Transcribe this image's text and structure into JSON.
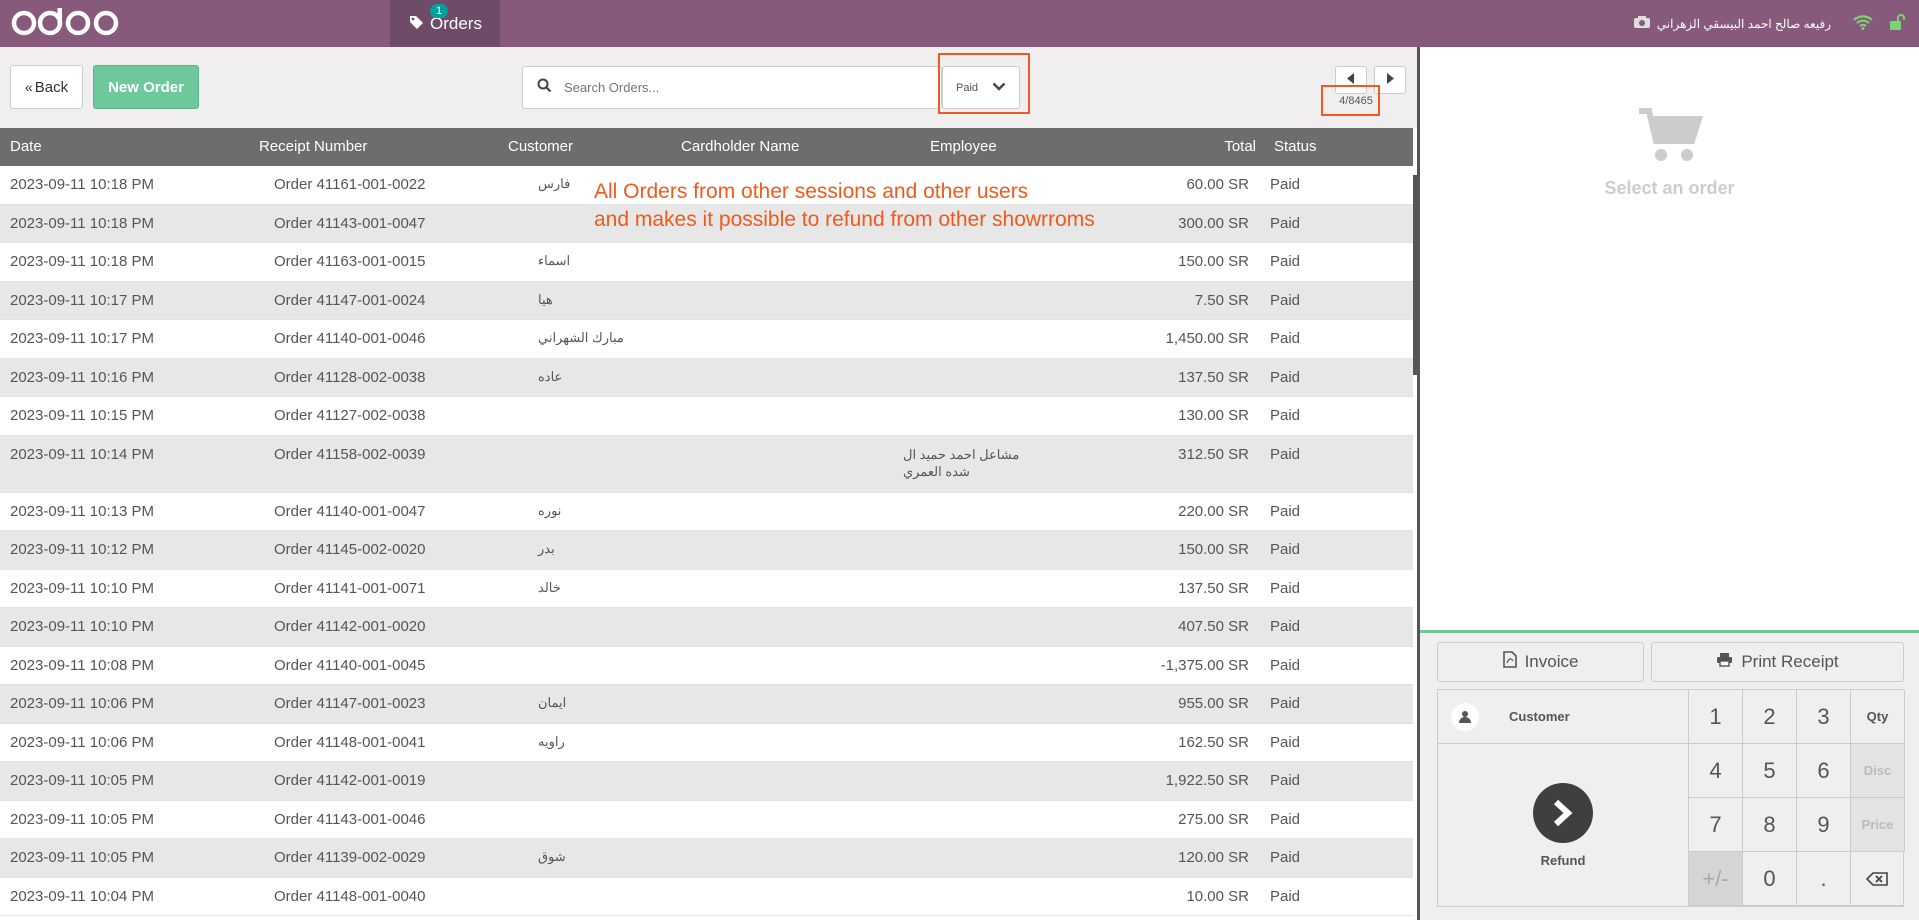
{
  "brand": "odoo",
  "topbar": {
    "orders_tab": "Orders",
    "orders_badge": "1",
    "cashier_name": "رفيعه صالح احمد البيسقي الزهراني"
  },
  "controls": {
    "back_label": "Back",
    "new_order_label": "New Order",
    "search_placeholder": "Search Orders...",
    "filter_value": "Paid",
    "pager": "4/8465"
  },
  "table": {
    "columns": [
      "Date",
      "Receipt Number",
      "Customer",
      "Cardholder Name",
      "Employee",
      "Total",
      "Status"
    ],
    "rows": [
      {
        "date": "2023-09-11 10:18 PM",
        "receipt": "Order 41161-001-0022",
        "customer": "فارس",
        "employee": "",
        "total": "60.00 SR",
        "status": "Paid"
      },
      {
        "date": "2023-09-11 10:18 PM",
        "receipt": "Order 41143-001-0047",
        "customer": "",
        "employee": "",
        "total": "300.00 SR",
        "status": "Paid"
      },
      {
        "date": "2023-09-11 10:18 PM",
        "receipt": "Order 41163-001-0015",
        "customer": "اسماء",
        "employee": "",
        "total": "150.00 SR",
        "status": "Paid"
      },
      {
        "date": "2023-09-11 10:17 PM",
        "receipt": "Order 41147-001-0024",
        "customer": "هيا",
        "employee": "",
        "total": "7.50 SR",
        "status": "Paid"
      },
      {
        "date": "2023-09-11 10:17 PM",
        "receipt": "Order 41140-001-0046",
        "customer": "مبارك الشهراني",
        "employee": "",
        "total": "1,450.00 SR",
        "status": "Paid"
      },
      {
        "date": "2023-09-11 10:16 PM",
        "receipt": "Order 41128-002-0038",
        "customer": "عاده",
        "employee": "",
        "total": "137.50 SR",
        "status": "Paid"
      },
      {
        "date": "2023-09-11 10:15 PM",
        "receipt": "Order 41127-002-0038",
        "customer": "",
        "employee": "",
        "total": "130.00 SR",
        "status": "Paid"
      },
      {
        "date": "2023-09-11 10:14 PM",
        "receipt": "Order 41158-002-0039",
        "customer": "",
        "employee": "مشاعل احمد حميد ال شده العمري",
        "total": "312.50 SR",
        "status": "Paid"
      },
      {
        "date": "2023-09-11 10:13 PM",
        "receipt": "Order 41140-001-0047",
        "customer": "نوره",
        "employee": "",
        "total": "220.00 SR",
        "status": "Paid"
      },
      {
        "date": "2023-09-11 10:12 PM",
        "receipt": "Order 41145-002-0020",
        "customer": "بدر",
        "employee": "",
        "total": "150.00 SR",
        "status": "Paid"
      },
      {
        "date": "2023-09-11 10:10 PM",
        "receipt": "Order 41141-001-0071",
        "customer": "خالد",
        "employee": "",
        "total": "137.50 SR",
        "status": "Paid"
      },
      {
        "date": "2023-09-11 10:10 PM",
        "receipt": "Order 41142-001-0020",
        "customer": "",
        "employee": "",
        "total": "407.50 SR",
        "status": "Paid"
      },
      {
        "date": "2023-09-11 10:08 PM",
        "receipt": "Order 41140-001-0045",
        "customer": "",
        "employee": "",
        "total": "-1,375.00 SR",
        "status": "Paid"
      },
      {
        "date": "2023-09-11 10:06 PM",
        "receipt": "Order 41147-001-0023",
        "customer": "ايمان",
        "employee": "",
        "total": "955.00 SR",
        "status": "Paid"
      },
      {
        "date": "2023-09-11 10:06 PM",
        "receipt": "Order 41148-001-0041",
        "customer": "راويه",
        "employee": "",
        "total": "162.50 SR",
        "status": "Paid"
      },
      {
        "date": "2023-09-11 10:05 PM",
        "receipt": "Order 41142-001-0019",
        "customer": "",
        "employee": "",
        "total": "1,922.50 SR",
        "status": "Paid"
      },
      {
        "date": "2023-09-11 10:05 PM",
        "receipt": "Order 41143-001-0046",
        "customer": "",
        "employee": "",
        "total": "275.00 SR",
        "status": "Paid"
      },
      {
        "date": "2023-09-11 10:05 PM",
        "receipt": "Order 41139-002-0029",
        "customer": "شوق",
        "employee": "",
        "total": "120.00 SR",
        "status": "Paid"
      },
      {
        "date": "2023-09-11 10:04 PM",
        "receipt": "Order 41148-001-0040",
        "customer": "",
        "employee": "",
        "total": "10.00 SR",
        "status": "Paid"
      }
    ]
  },
  "annotation": {
    "line1": "All Orders from other sessions and other users",
    "line2": "and makes it possible to refund from other showrroms"
  },
  "right_panel": {
    "empty_label": "Select an order",
    "invoice_label": "Invoice",
    "print_label": "Print Receipt",
    "customer_label": "Customer",
    "refund_label": "Refund",
    "keys": [
      "1",
      "2",
      "3",
      "Qty",
      "4",
      "5",
      "6",
      "Disc",
      "7",
      "8",
      "9",
      "Price",
      "+/-",
      "0",
      "."
    ]
  },
  "colors": {
    "brand": "#875a7b",
    "accent_green": "#6ec89b",
    "annotation": "#f05a1a",
    "header_gray": "#6d6d6d"
  }
}
